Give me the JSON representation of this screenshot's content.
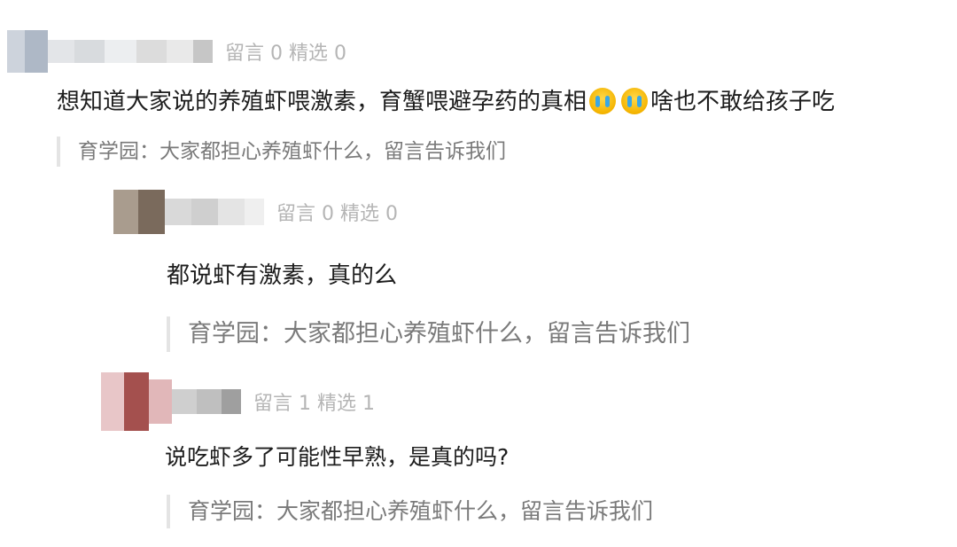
{
  "comments": [
    {
      "meta": "留言 0 精选 0",
      "text_before": "想知道大家说的养殖虾喂激素，育蟹喂避孕药的真相",
      "emojis": [
        "crying-face-icon",
        "crying-face-icon"
      ],
      "text_after": "啥也不敢给孩子吃",
      "reply": "育学园：大家都担心养殖虾什么，留言告诉我们"
    },
    {
      "meta": "留言 0 精选 0",
      "text_before": "都说虾有激素，真的么",
      "reply": "育学园：大家都担心养殖虾什么，留言告诉我们"
    },
    {
      "meta": "留言 1 精选 1",
      "text_before": "说吃虾多了可能性早熟，是真的吗?",
      "reply": "育学园：大家都担心养殖虾什么，留言告诉我们"
    }
  ]
}
